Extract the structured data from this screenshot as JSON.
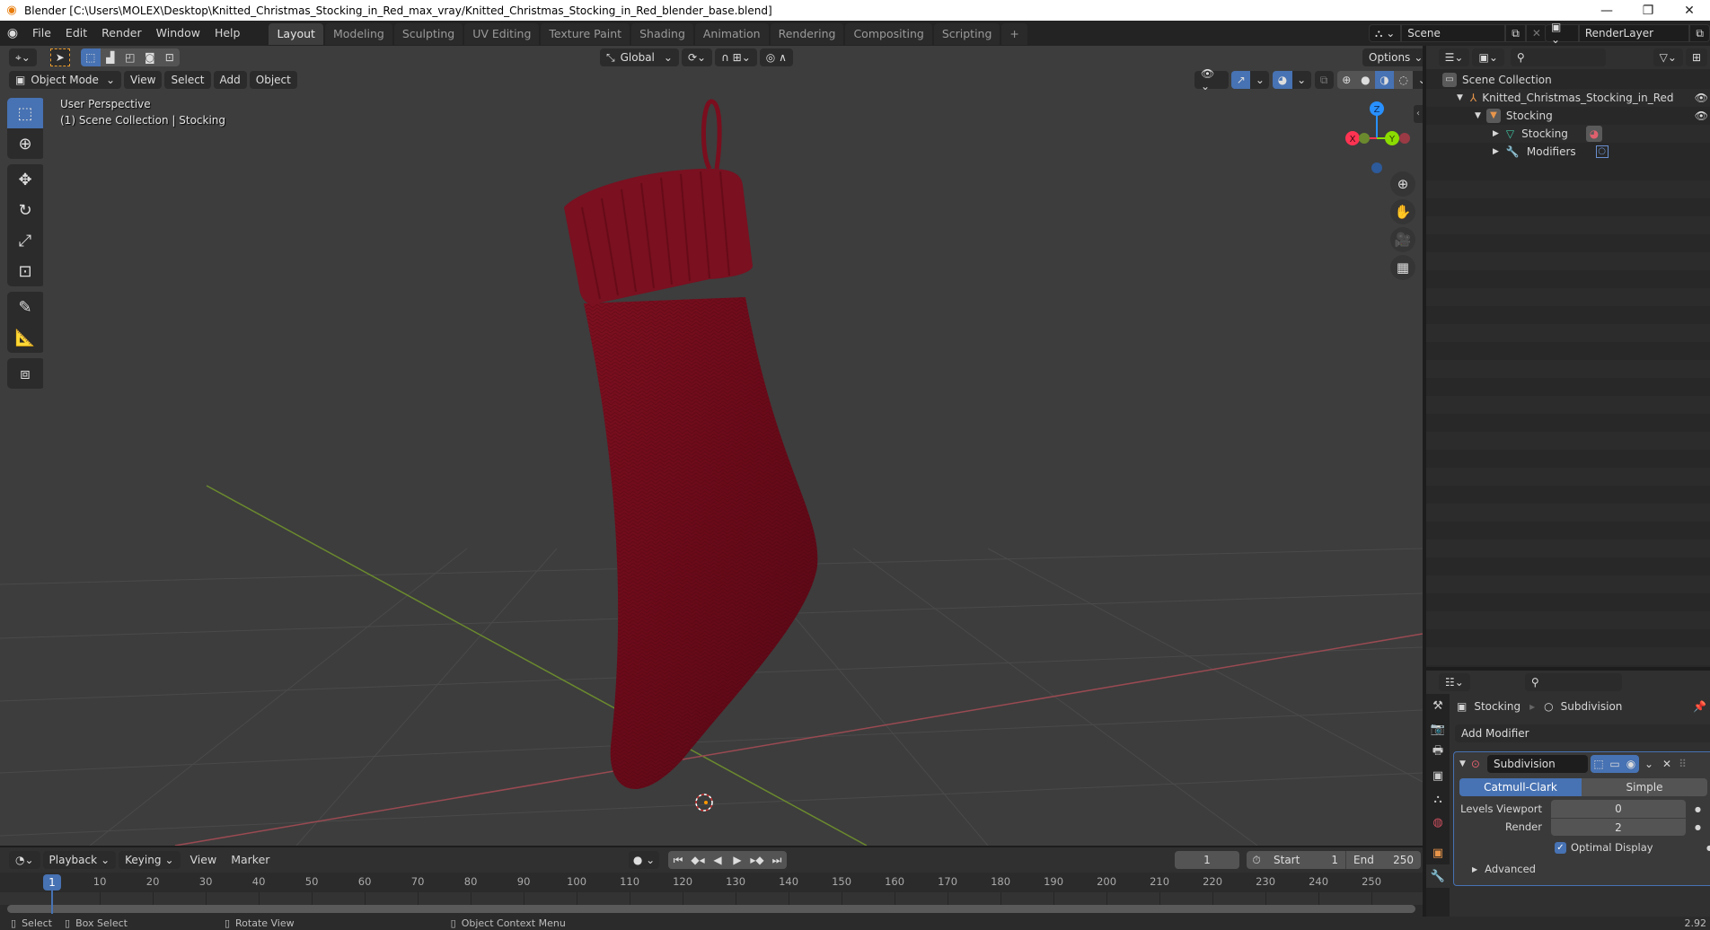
{
  "window": {
    "title": "Blender [C:\\Users\\MOLEX\\Desktop\\Knitted_Christmas_Stocking_in_Red_max_vray/Knitted_Christmas_Stocking_in_Red_blender_base.blend]",
    "minimize": "—",
    "maximize": "❐",
    "close": "✕"
  },
  "menu": [
    "File",
    "Edit",
    "Render",
    "Window",
    "Help"
  ],
  "workspaces": [
    "Layout",
    "Modeling",
    "Sculpting",
    "UV Editing",
    "Texture Paint",
    "Shading",
    "Animation",
    "Rendering",
    "Compositing",
    "Scripting"
  ],
  "workspace_add": "+",
  "scene": {
    "name": "Scene",
    "view_layer": "RenderLayer"
  },
  "viewport": {
    "mode": "Object Mode",
    "menus": [
      "View",
      "Select",
      "Add",
      "Object"
    ],
    "transform_orientation": "Global",
    "options_label": "Options",
    "overlay_line1": "User Perspective",
    "overlay_line2": "(1) Scene Collection | Stocking",
    "gizmo": {
      "x": "X",
      "y": "Y",
      "z": "Z"
    }
  },
  "outliner": {
    "search_placeholder": "",
    "items": [
      {
        "label": "Scene Collection",
        "icon": "collection-box-icon",
        "depth": 0
      },
      {
        "label": "Knitted_Christmas_Stocking_in_Red",
        "icon": "empty-axes-icon",
        "depth": 1,
        "expanded": true,
        "visible": true
      },
      {
        "label": "Stocking",
        "icon": "mesh-object-icon",
        "depth": 2,
        "expanded": true,
        "visible": true
      },
      {
        "label": "Stocking",
        "icon": "mesh-data-icon",
        "depth": 3,
        "expanded": false
      },
      {
        "label": "Modifiers",
        "icon": "wrench-icon",
        "depth": 3,
        "expanded": false
      }
    ]
  },
  "properties": {
    "breadcrumb_object": "Stocking",
    "breadcrumb_modifier": "Subdivision",
    "add_modifier": "Add Modifier",
    "modifier": {
      "name": "Subdivision",
      "type_options": [
        "Catmull-Clark",
        "Simple"
      ],
      "selected_type": "Catmull-Clark",
      "levels_viewport_label": "Levels Viewport",
      "levels_viewport": "0",
      "render_label": "Render",
      "render": "2",
      "optimal_display_label": "Optimal Display",
      "optimal_display": true,
      "advanced_label": "Advanced"
    }
  },
  "timeline": {
    "menus": [
      "Playback",
      "Keying",
      "View",
      "Marker"
    ],
    "current_frame": "1",
    "start_label": "Start",
    "start": "1",
    "end_label": "End",
    "end": "250",
    "ruler_ticks": [
      "10",
      "20",
      "30",
      "40",
      "50",
      "60",
      "70",
      "80",
      "90",
      "100",
      "110",
      "120",
      "130",
      "140",
      "150",
      "160",
      "170",
      "180",
      "190",
      "200",
      "210",
      "220",
      "230",
      "240",
      "250"
    ],
    "playhead_label": "1"
  },
  "statusbar": {
    "select": "Select",
    "box_select": "Box Select",
    "rotate_view": "Rotate View",
    "context_menu": "Object Context Menu",
    "version": "2.92"
  },
  "colors": {
    "accent_blue": "#4772b3",
    "stocking_red": "#6e0a1a",
    "x_axis": "#ff3352",
    "y_axis": "#8bdc00",
    "z_axis": "#2890ff"
  }
}
